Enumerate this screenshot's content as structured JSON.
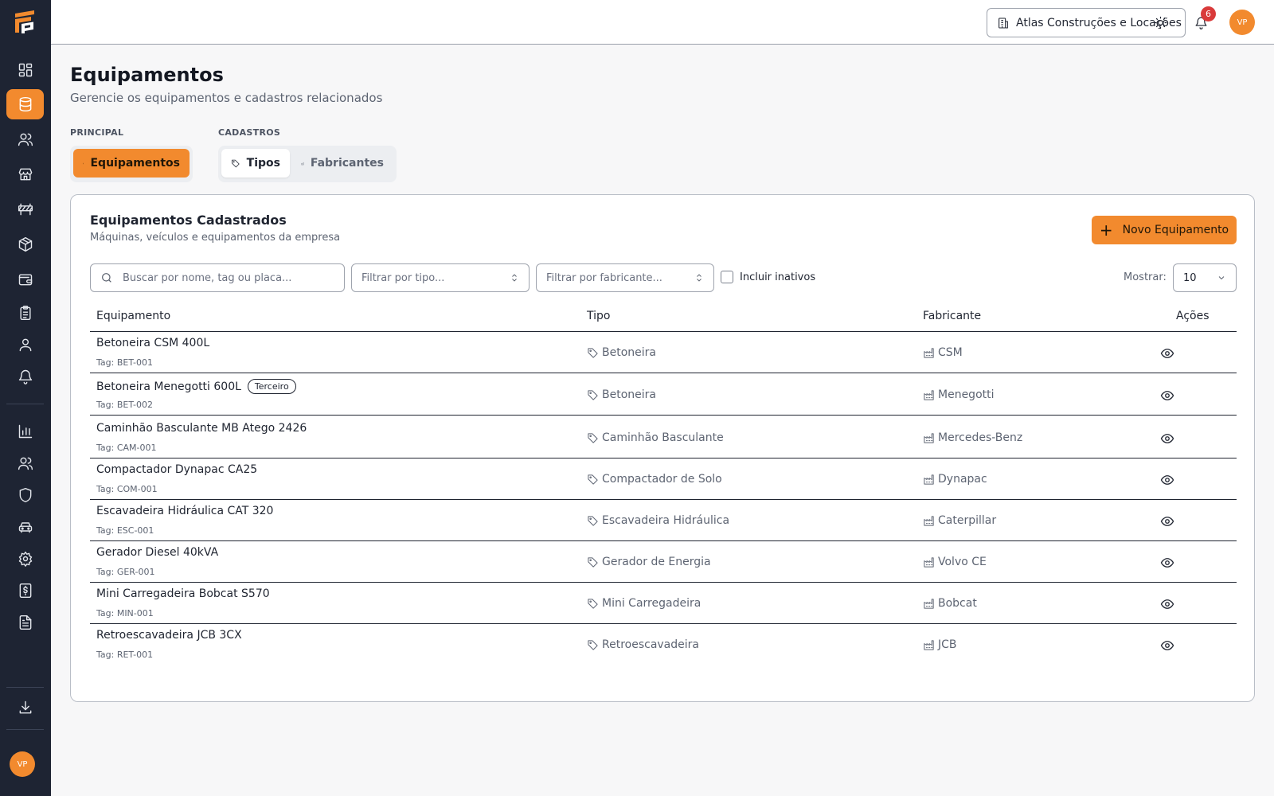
{
  "header": {
    "company": "Atlas Construções e Locações",
    "notification_count": "6",
    "avatar_initials": "VP"
  },
  "sidebar": {
    "avatar_initials": "VP",
    "items": [
      {
        "icon": "dashboard-icon"
      },
      {
        "icon": "database-icon",
        "active": true
      },
      {
        "icon": "users-icon"
      },
      {
        "icon": "store-icon"
      },
      {
        "icon": "barrier-icon"
      },
      {
        "icon": "package-icon"
      },
      {
        "icon": "wallet-icon"
      },
      {
        "icon": "clipboard-icon"
      },
      {
        "icon": "user-icon"
      },
      {
        "icon": "bell-icon"
      },
      {
        "icon": "chart-icon"
      },
      {
        "icon": "team-icon"
      },
      {
        "icon": "shield-icon"
      },
      {
        "icon": "car-icon"
      },
      {
        "icon": "settings-icon"
      },
      {
        "icon": "invoice-icon"
      },
      {
        "icon": "document-icon"
      },
      {
        "icon": "download-icon"
      }
    ]
  },
  "page": {
    "title": "Equipamentos",
    "subtitle": "Gerencie os equipamentos e cadastros relacionados"
  },
  "tabs": {
    "principal_label": "PRINCIPAL",
    "cadastros_label": "CADASTROS",
    "equipamentos": "Equipamentos",
    "tipos": "Tipos",
    "fabricantes": "Fabricantes"
  },
  "card": {
    "title": "Equipamentos Cadastrados",
    "subtitle": "Máquinas, veículos e equipamentos da empresa",
    "new_button": "Novo Equipamento"
  },
  "filters": {
    "search_placeholder": "Buscar por nome, tag ou placa...",
    "type_placeholder": "Filtrar por tipo...",
    "manufacturer_placeholder": "Filtrar por fabricante...",
    "include_inactive": "Incluir inativos",
    "show_label": "Mostrar:",
    "page_size": "10"
  },
  "table": {
    "columns": [
      "Equipamento",
      "Tipo",
      "Fabricante",
      "Ações"
    ],
    "rows": [
      {
        "name": "Betoneira CSM 400L",
        "tag": "Tag: BET-001",
        "badge": "",
        "type": "Betoneira",
        "manufacturer": "CSM"
      },
      {
        "name": "Betoneira Menegotti 600L",
        "tag": "Tag: BET-002",
        "badge": "Terceiro",
        "type": "Betoneira",
        "manufacturer": "Menegotti"
      },
      {
        "name": "Caminhão Basculante MB Atego 2426",
        "tag": "Tag: CAM-001",
        "badge": "",
        "type": "Caminhão Basculante",
        "manufacturer": "Mercedes-Benz"
      },
      {
        "name": "Compactador Dynapac CA25",
        "tag": "Tag: COM-001",
        "badge": "",
        "type": "Compactador de Solo",
        "manufacturer": "Dynapac"
      },
      {
        "name": "Escavadeira Hidráulica CAT 320",
        "tag": "Tag: ESC-001",
        "badge": "",
        "type": "Escavadeira Hidráulica",
        "manufacturer": "Caterpillar"
      },
      {
        "name": "Gerador Diesel 40kVA",
        "tag": "Tag: GER-001",
        "badge": "",
        "type": "Gerador de Energia",
        "manufacturer": "Volvo CE"
      },
      {
        "name": "Mini Carregadeira Bobcat S570",
        "tag": "Tag: MIN-001",
        "badge": "",
        "type": "Mini Carregadeira",
        "manufacturer": "Bobcat"
      },
      {
        "name": "Retroescavadeira JCB 3CX",
        "tag": "Tag: RET-001",
        "badge": "",
        "type": "Retroescavadeira",
        "manufacturer": "JCB"
      }
    ]
  },
  "colors": {
    "accent": "#f28a2e",
    "sidebar": "#1e2433",
    "badge_red": "#d93a3a"
  }
}
